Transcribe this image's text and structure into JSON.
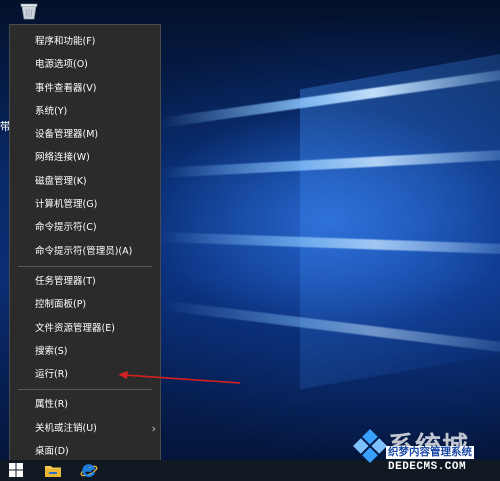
{
  "desktop": {
    "partial_label": "带"
  },
  "menu": {
    "groups": [
      [
        {
          "label": "程序和功能(F)"
        },
        {
          "label": "电源选项(O)"
        },
        {
          "label": "事件查看器(V)"
        },
        {
          "label": "系统(Y)"
        },
        {
          "label": "设备管理器(M)"
        },
        {
          "label": "网络连接(W)"
        },
        {
          "label": "磁盘管理(K)"
        },
        {
          "label": "计算机管理(G)"
        },
        {
          "label": "命令提示符(C)"
        },
        {
          "label": "命令提示符(管理员)(A)"
        }
      ],
      [
        {
          "label": "任务管理器(T)"
        },
        {
          "label": "控制面板(P)"
        },
        {
          "label": "文件资源管理器(E)"
        },
        {
          "label": "搜索(S)"
        },
        {
          "label": "运行(R)"
        }
      ],
      [
        {
          "label": "属性(R)"
        },
        {
          "label": "关机或注销(U)",
          "submenu_arrow": "›"
        },
        {
          "label": "桌面(D)"
        }
      ]
    ]
  },
  "annotation": {
    "color": "#d42020",
    "points_to": "运行(R)"
  },
  "taskbar": {
    "icons": [
      "windows-start-icon",
      "file-explorer-icon",
      "internet-explorer-icon"
    ]
  },
  "watermark": {
    "big_text": "系统城",
    "small_text": "织梦内容管理系统",
    "url": "DEDECMS.COM"
  },
  "colors": {
    "menu_bg": "#2b2b2b",
    "menu_text": "#ffffff",
    "separator": "#5a5a5a",
    "taskbar_bg": "#101822",
    "accent_blue": "#1e7fe0"
  }
}
